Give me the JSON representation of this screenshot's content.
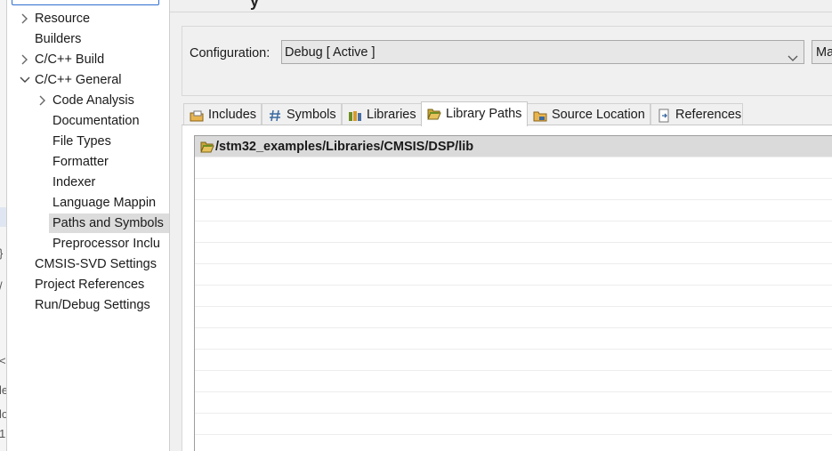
{
  "sidebar": {
    "items": [
      {
        "label": "Resource",
        "expandable": true,
        "expanded": false
      },
      {
        "label": "Builders",
        "expandable": false
      },
      {
        "label": "C/C++ Build",
        "expandable": true,
        "expanded": false
      },
      {
        "label": "C/C++ General",
        "expandable": true,
        "expanded": true
      },
      {
        "label": "Code Analysis",
        "expandable": true,
        "expanded": false
      },
      {
        "label": "Documentation",
        "expandable": false
      },
      {
        "label": "File Types",
        "expandable": false
      },
      {
        "label": "Formatter",
        "expandable": false
      },
      {
        "label": "Indexer",
        "expandable": false
      },
      {
        "label": "Language Mappin",
        "expandable": false
      },
      {
        "label": "Paths and Symbols",
        "expandable": false,
        "selected": true
      },
      {
        "label": "Preprocessor Inclu",
        "expandable": false
      },
      {
        "label": "CMSIS-SVD Settings",
        "expandable": false
      },
      {
        "label": "Project References",
        "expandable": false
      },
      {
        "label": "Run/Debug Settings",
        "expandable": false
      }
    ]
  },
  "editor_edge": {
    "chars": [
      "}",
      "/",
      "<",
      "le",
      "lo",
      "1"
    ]
  },
  "page_title": "y",
  "config": {
    "label": "Configuration:",
    "value": "Debug  [ Active ]",
    "manage_label": "Ma"
  },
  "tabs": [
    {
      "label": "Includes",
      "icon": "includes-icon"
    },
    {
      "label": "Symbols",
      "icon": "hash-icon"
    },
    {
      "label": "Libraries",
      "icon": "libraries-icon"
    },
    {
      "label": "Library Paths",
      "icon": "folder-open-icon",
      "active": true
    },
    {
      "label": "Source Location",
      "icon": "source-folder-icon"
    },
    {
      "label": "References",
      "icon": "references-icon"
    }
  ],
  "library_paths": [
    "/stm32_examples/Libraries/CMSIS/DSP/lib"
  ],
  "colors": {
    "accent": "#2f6fd0",
    "selection": "#dadada"
  }
}
